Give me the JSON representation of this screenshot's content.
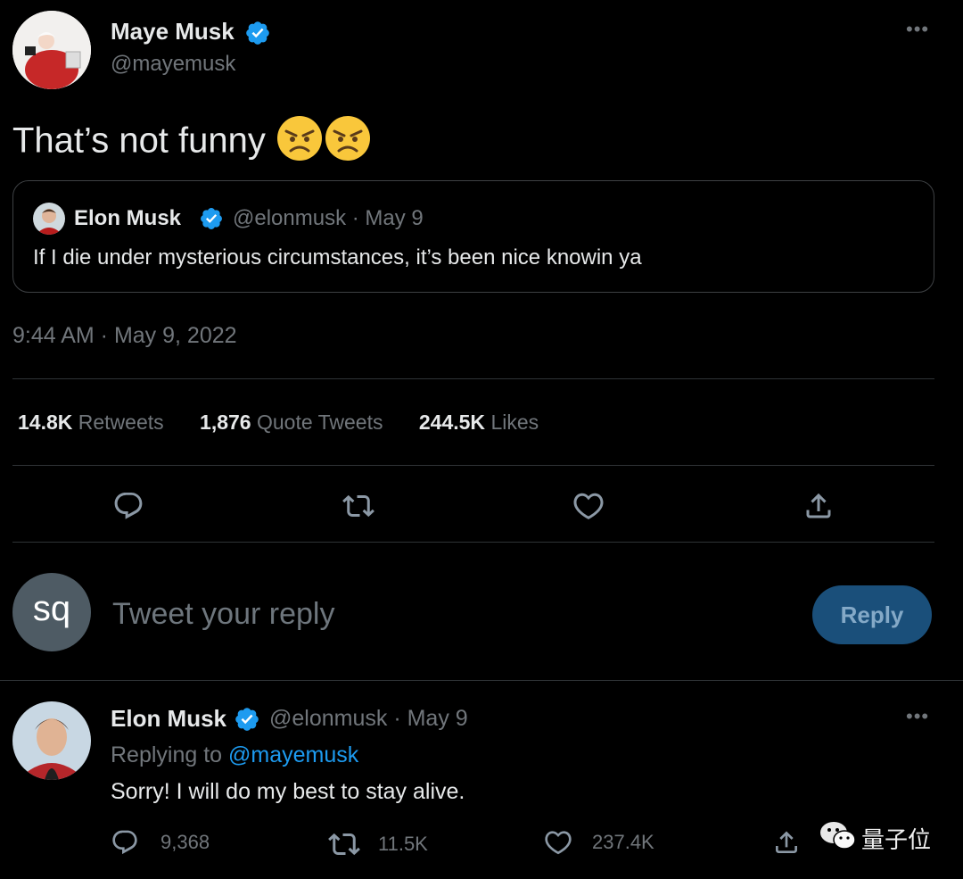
{
  "main_tweet": {
    "author_name": "Maye Musk",
    "author_handle": "@mayemusk",
    "text": "That’s not funny",
    "timestamp": "9:44 AM · May 9, 2022",
    "quoted": {
      "author_name": "Elon Musk",
      "handle_date": "@elonmusk · May 9",
      "text": "If I die under mysterious circumstances, it’s been nice knowin ya"
    },
    "stats": {
      "retweets_count": "14.8K",
      "retweets_label": "Retweets",
      "quotes_count": "1,876",
      "quotes_label": "Quote Tweets",
      "likes_count": "244.5K",
      "likes_label": "Likes"
    }
  },
  "composer": {
    "avatar_initials": "sq",
    "placeholder": "Tweet your reply",
    "reply_label": "Reply"
  },
  "reply_tweet": {
    "author_name": "Elon Musk",
    "handle_date": "@elonmusk · May 9",
    "replying_prefix": "Replying to",
    "replying_handle": "@mayemusk",
    "text": "Sorry! I will do my best to stay alive.",
    "counts": {
      "replies": "9,368",
      "retweets": "11.5K",
      "likes": "237.4K"
    }
  },
  "watermark": {
    "text": "量子位"
  },
  "colors": {
    "background": "#000000",
    "accent": "#1d9bf0",
    "muted": "#71767b",
    "border": "#2f3336",
    "reply_button": "#1a4f7a"
  },
  "icons": [
    "verified-badge-icon",
    "more-icon",
    "reply-icon",
    "retweet-icon",
    "like-icon",
    "share-icon",
    "angry-face-emoji",
    "wechat-icon"
  ]
}
